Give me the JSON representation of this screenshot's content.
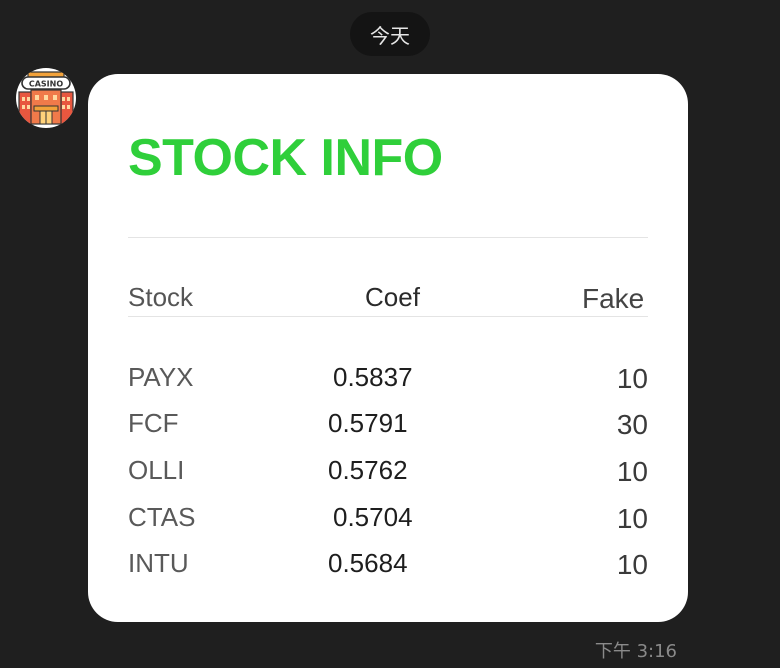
{
  "chat": {
    "date_label": "今天",
    "timestamp": "下午 3:16",
    "avatar_icon": "casino-icon",
    "avatar_text": "CASINO"
  },
  "card": {
    "title": "STOCK INFO",
    "title_color": "#2fcf3a",
    "headers": {
      "stock": "Stock",
      "coef": "Coef",
      "fake": "Fake"
    },
    "rows": [
      {
        "symbol": "PAYX",
        "coef": "0.5837",
        "fake": "10"
      },
      {
        "symbol": "FCF",
        "coef": "0.5791",
        "fake": "30"
      },
      {
        "symbol": "OLLI",
        "coef": "0.5762",
        "fake": "10"
      },
      {
        "symbol": "CTAS",
        "coef": "0.5704",
        "fake": "10"
      },
      {
        "symbol": "INTU",
        "coef": "0.5684",
        "fake": "10"
      }
    ]
  }
}
